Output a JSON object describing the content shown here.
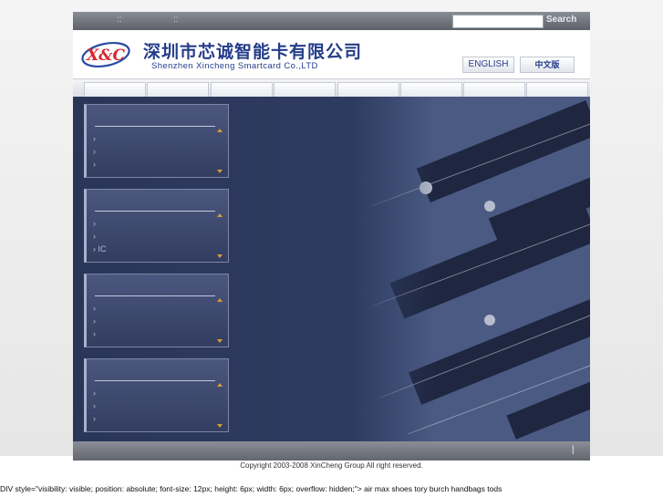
{
  "topbar": {
    "separators": [
      "::",
      "::"
    ],
    "search_placeholder": "",
    "search_label": "Search"
  },
  "header": {
    "logo_text": "X&C",
    "company_cn": "深圳市芯诚智能卡有限公司",
    "company_en": "Shenzhen Xincheng Smartcard Co.,LTD",
    "lang_english": "ENGLISH",
    "lang_chinese": "中文版"
  },
  "nav": {
    "tab_count": 8
  },
  "panels": [
    {
      "items": [
        "›",
        "›",
        "›"
      ]
    },
    {
      "items": [
        "›",
        "›",
        "›  IC"
      ]
    },
    {
      "items": [
        "›",
        "›",
        "›"
      ]
    },
    {
      "items": [
        "›",
        "›",
        "›"
      ]
    }
  ],
  "footer": {
    "bar_mark": "|",
    "copyright": "Copyright 2003-2008 XinCheng Group All right reserved."
  },
  "leaked_text": "DIV style=\"visibility: visible; position: absolute; font-size: 12px; height: 6px; width: 6px; overflow: hidden;\"> air max shoes tory burch handbags tods",
  "colors": {
    "brand_blue": "#253d8a",
    "logo_red": "#d8272d",
    "main_bg": "#2f3c62",
    "accent_orange": "#d79b3a"
  }
}
